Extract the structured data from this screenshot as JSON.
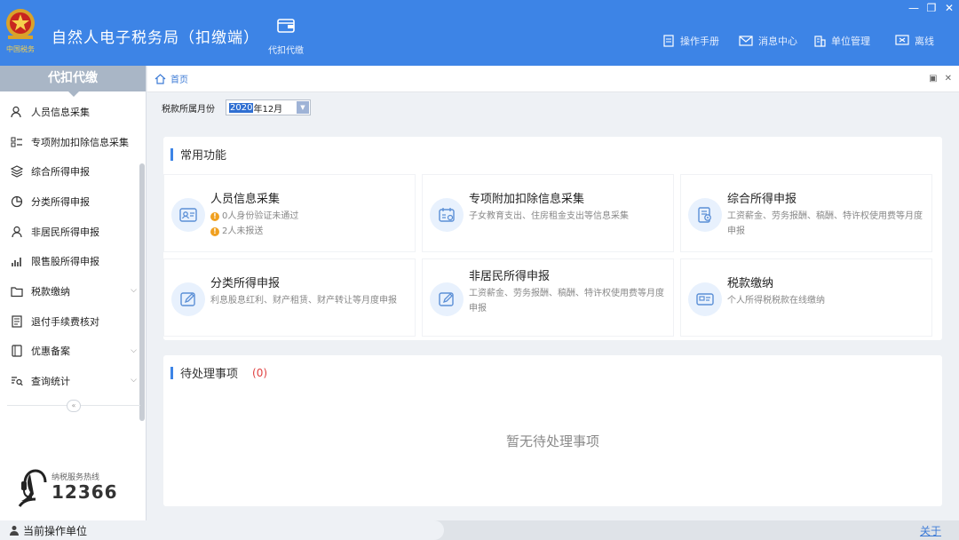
{
  "app": {
    "title": "自然人电子税务局（扣缴端）",
    "top_tab": "代扣代缴",
    "top_menu": [
      "操作手册",
      "消息中心",
      "单位管理",
      "离线"
    ]
  },
  "sidebar": {
    "header": "代扣代缴",
    "items": [
      {
        "label": "人员信息采集",
        "icon": "person-icon"
      },
      {
        "label": "专项附加扣除信息采集",
        "icon": "list-icon"
      },
      {
        "label": "综合所得申报",
        "icon": "layers-icon"
      },
      {
        "label": "分类所得申报",
        "icon": "pie-chart-icon"
      },
      {
        "label": "非居民所得申报",
        "icon": "person-outline-icon"
      },
      {
        "label": "限售股所得申报",
        "icon": "bar-chart-icon"
      },
      {
        "label": "税款缴纳",
        "icon": "folder-icon",
        "expandable": true
      },
      {
        "label": "退付手续费核对",
        "icon": "document-icon"
      },
      {
        "label": "优惠备案",
        "icon": "file-icon",
        "expandable": true
      },
      {
        "label": "查询统计",
        "icon": "search-list-icon",
        "expandable": true
      }
    ],
    "hotline_label": "纳税服务热线",
    "hotline_number": "12366"
  },
  "breadcrumb": {
    "home": "首页"
  },
  "period": {
    "label": "税款所属月份",
    "year": "2020",
    "month": "年12月"
  },
  "common": {
    "title": "常用功能",
    "tiles": [
      {
        "title": "人员信息采集",
        "warnings": [
          "0人身份验证未通过",
          "2人未报送"
        ]
      },
      {
        "title": "专项附加扣除信息采集",
        "desc": "子女教育支出、住房租金支出等信息采集"
      },
      {
        "title": "综合所得申报",
        "desc": "工资薪金、劳务报酬、稿酬、特许权使用费等月度申报"
      },
      {
        "title": "分类所得申报",
        "desc": "利息股息红利、财产租赁、财产转让等月度申报"
      },
      {
        "title": "非居民所得申报",
        "desc": "工资薪金、劳务报酬、稿酬、特许权使用费等月度申报"
      },
      {
        "title": "税款缴纳",
        "desc": "个人所得税税款在线缴纳"
      }
    ]
  },
  "pending": {
    "title": "待处理事项",
    "count": "(0)",
    "empty": "暂无待处理事项"
  },
  "status": {
    "left": "当前操作单位",
    "right": "关于"
  },
  "colors": {
    "primary": "#3d84e6",
    "sidebar_header": "#a9b6c6",
    "warning": "#f0a020",
    "count_red": "#e04040"
  }
}
